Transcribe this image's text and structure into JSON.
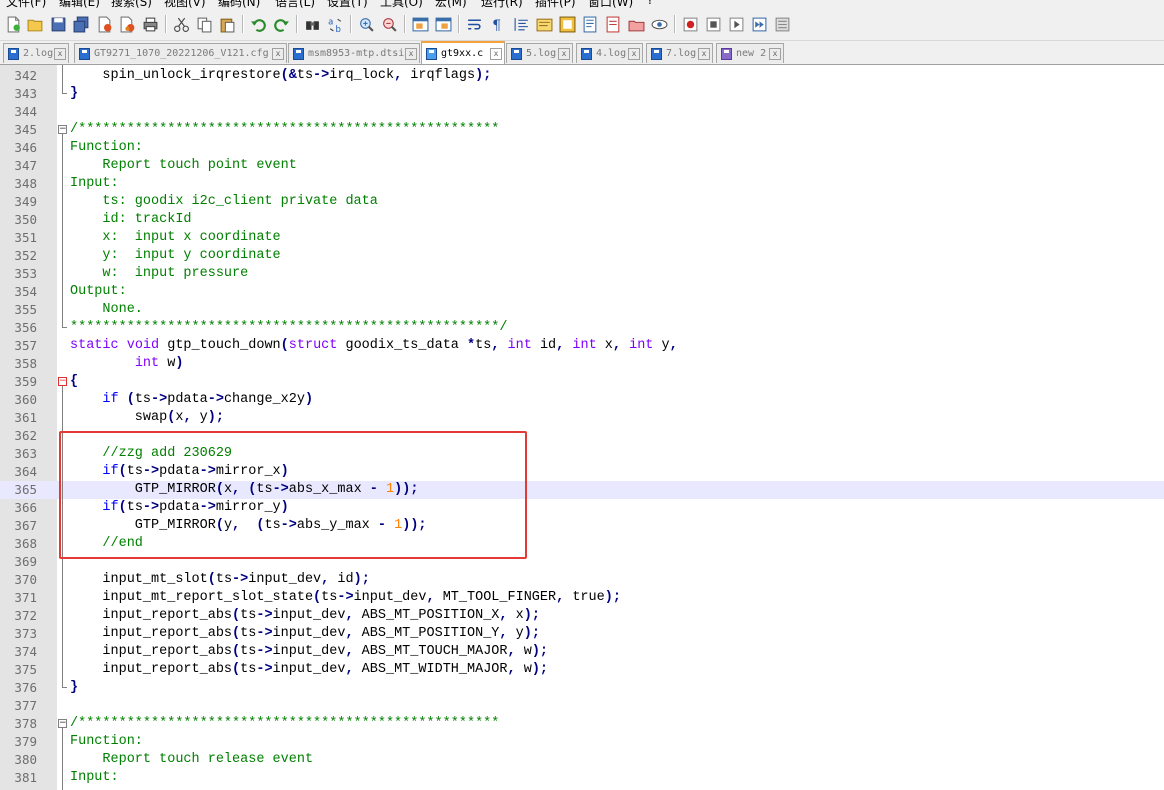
{
  "menu": [
    "文件(F)",
    "编辑(E)",
    "搜索(S)",
    "视图(V)",
    "编码(N)",
    "语言(L)",
    "设置(T)",
    "工具(O)",
    "宏(M)",
    "运行(R)",
    "插件(P)",
    "窗口(W)",
    "?"
  ],
  "toolbar_icons": [
    "new-file-icon",
    "open-file-icon",
    "save-icon",
    "save-all-icon",
    "close-icon",
    "close-all-icon",
    "print-icon",
    "cut-icon",
    "copy-icon",
    "paste-icon",
    "undo-icon",
    "redo-icon",
    "find-icon",
    "replace-icon",
    "zoom-in-icon",
    "zoom-out-icon",
    "sync-vertical-icon",
    "sync-horizontal-icon",
    "word-wrap-icon",
    "show-all-chars-icon",
    "indent-guide-icon",
    "lang-icon",
    "doc-map-icon",
    "function-list-icon",
    "folder-workspace-icon",
    "monitor-icon",
    "record-macro-icon",
    "stop-macro-icon",
    "play-macro-icon",
    "run-macro-multiple-icon",
    "save-macro-icon"
  ],
  "tabs": [
    {
      "label": "2.log",
      "active": false
    },
    {
      "label": "GT9271_1070_20221206_V121.cfg",
      "active": false
    },
    {
      "label": "msm8953-mtp.dtsi",
      "active": false
    },
    {
      "label": "gt9xx.c",
      "active": true
    },
    {
      "label": "5.log",
      "active": false
    },
    {
      "label": "4.log",
      "active": false
    },
    {
      "label": "7.log",
      "active": false
    },
    {
      "label": "new 2",
      "active": false
    }
  ],
  "tab_close_glyph": "x",
  "line_numbers": [
    "342",
    "343",
    "344",
    "345",
    "346",
    "347",
    "348",
    "349",
    "350",
    "351",
    "352",
    "353",
    "354",
    "355",
    "356",
    "357",
    "358",
    "359",
    "360",
    "361",
    "362",
    "363",
    "364",
    "365",
    "366",
    "367",
    "368",
    "369",
    "370",
    "371",
    "372",
    "373",
    "374",
    "375",
    "376",
    "377",
    "378",
    "379",
    "380",
    "381"
  ],
  "current_line": "365",
  "highlighted_block": {
    "from": "363",
    "to": "368",
    "color": "#e53935"
  },
  "colors": {
    "comment": "#008000",
    "keyword": "#0000ff",
    "type": "#8000ff",
    "number": "#ff8000",
    "operator": "#000080",
    "gutter": "#e4e4e4",
    "current_line": "#e8e8ff"
  }
}
